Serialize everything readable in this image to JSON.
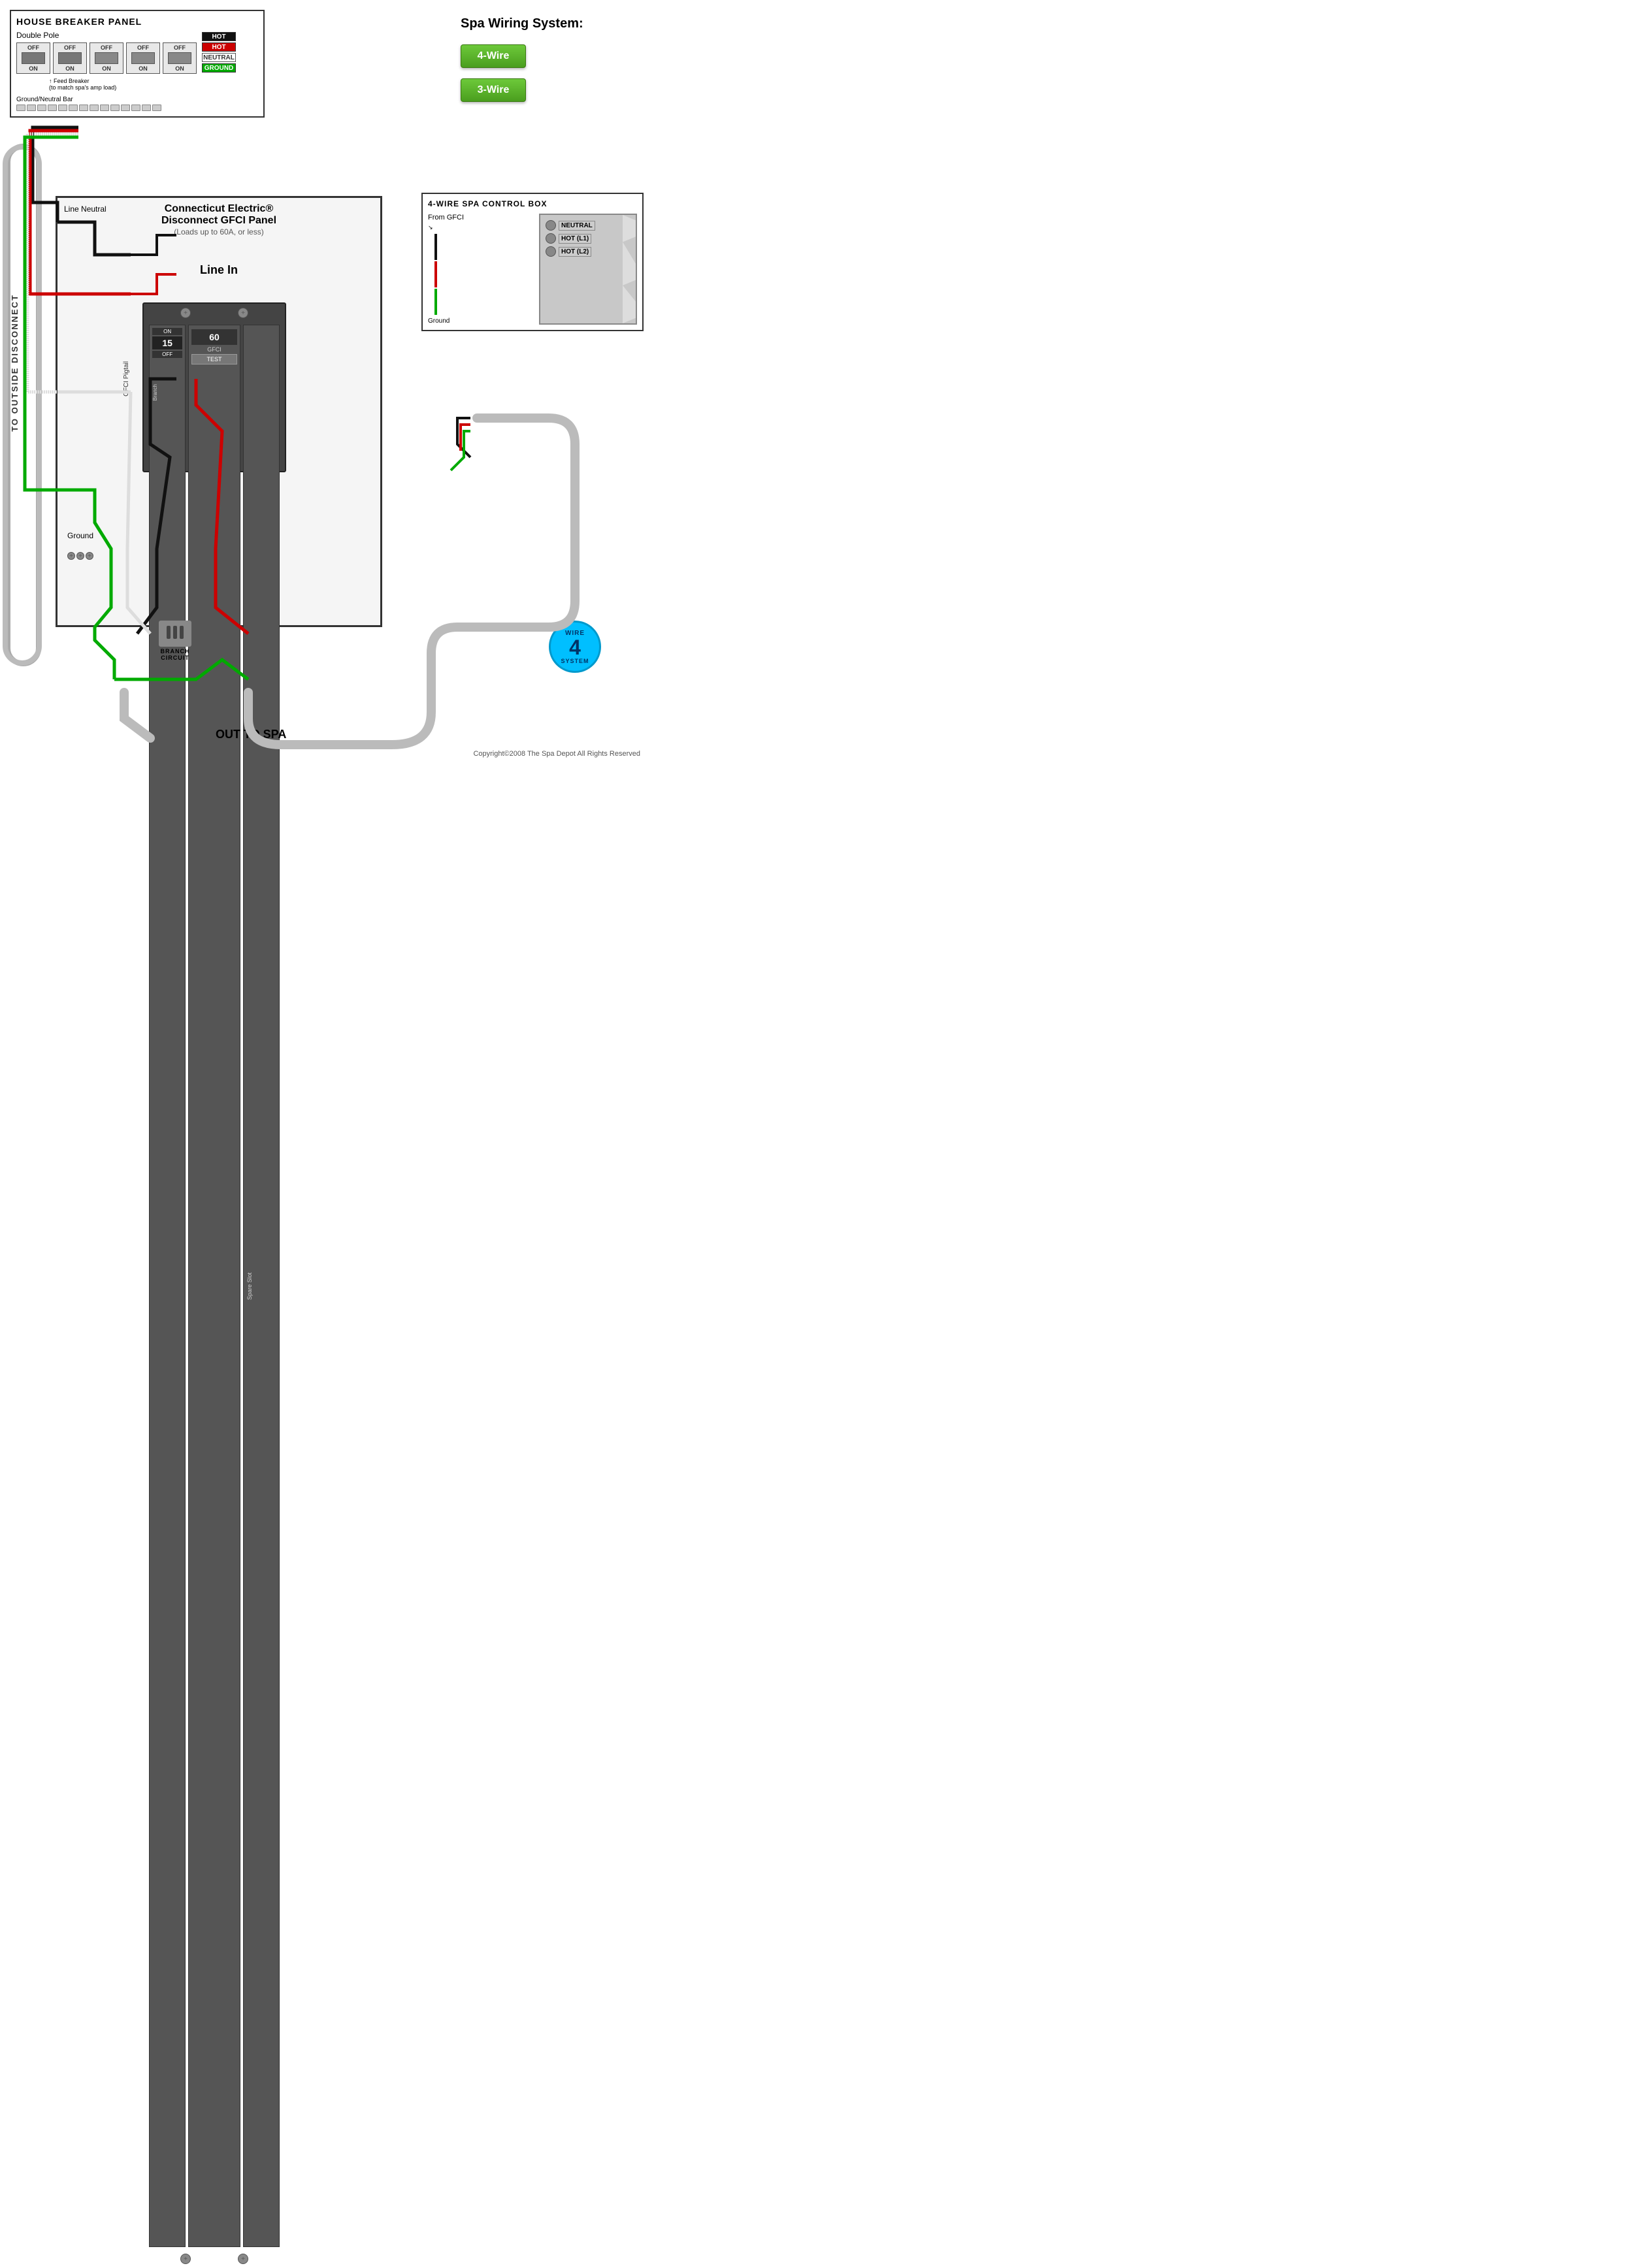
{
  "house_breaker_panel": {
    "title": "HOUSE BREAKER PANEL",
    "double_pole_label": "Double Pole",
    "breakers": [
      {
        "off": "OFF",
        "on": "ON",
        "active": true
      },
      {
        "off": "OFF",
        "on": "ON",
        "active": true
      },
      {
        "off": "OFF",
        "on": "ON",
        "active": false
      },
      {
        "off": "OFF",
        "on": "ON",
        "active": false
      },
      {
        "off": "OFF",
        "on": "ON",
        "active": false
      }
    ],
    "legend": [
      {
        "label": "HOT",
        "color_class": "hot-black"
      },
      {
        "label": "HOT",
        "color_class": "hot-red"
      },
      {
        "label": "NEUTRAL",
        "color_class": "neutral"
      },
      {
        "label": "GROUND",
        "color_class": "ground"
      }
    ],
    "feed_breaker_label": "Feed Breaker",
    "feed_breaker_sublabel": "(to match spa's amp load)",
    "ground_neutral_bar_label": "Ground/Neutral Bar"
  },
  "gfci_panel": {
    "title": "Connecticut Electric®",
    "title2": "Disconnect GFCI Panel",
    "subtitle": "(Loads up to 60A, or less)",
    "line_in_label": "Line In",
    "line_neutral_label": "Line Neutral",
    "gfci_pigtail_label": "GFCI Pigtail",
    "branch_label": "Branch",
    "branch_number": "15",
    "on_label": "ON",
    "off_label": "OFF",
    "gfci_label": "GFCI",
    "gfci_number": "60",
    "gfci_test_label": "TEST",
    "spare_slot_label": "Spare Slot",
    "ground_label": "Ground",
    "branch_circuit_label": "BRANCH\nCIRCUIT",
    "out_to_spa_label": "OUT TO SPA"
  },
  "to_outside_label": "TO OUTSIDE DISCONNECT",
  "spa_wiring": {
    "title": "Spa Wiring System:",
    "options": [
      {
        "label": "4-Wire"
      },
      {
        "label": "3-Wire"
      }
    ]
  },
  "spa_control_box": {
    "title": "4-WIRE SPA CONTROL BOX",
    "from_gfci_label": "From GFCI",
    "connections": [
      {
        "label": "NEUTRAL"
      },
      {
        "label": "HOT (L1)"
      },
      {
        "label": "HOT (L2)"
      }
    ],
    "ground_label": "Ground"
  },
  "wire_badge": {
    "top": "WIRE",
    "number": "4",
    "bottom": "SYSTEM"
  },
  "copyright": "Copyright©2008 The Spa Depot All Rights Reserved"
}
